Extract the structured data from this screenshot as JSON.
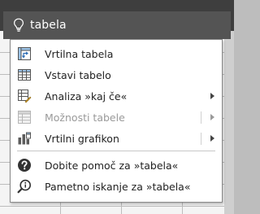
{
  "search": {
    "query": "tabela"
  },
  "menu": {
    "items": [
      {
        "label": "Vrtilna tabela",
        "icon": "pivot-table-icon",
        "submenu": false,
        "disabled": false
      },
      {
        "label": "Vstavi tabelo",
        "icon": "table-icon",
        "submenu": false,
        "disabled": false
      },
      {
        "label": "Analiza »kaj če«",
        "icon": "what-if-analysis-icon",
        "submenu": true,
        "disabled": false
      },
      {
        "label": "Možnosti tabele",
        "icon": "table-options-icon",
        "submenu": true,
        "disabled": true
      },
      {
        "label": "Vrtilni grafikon",
        "icon": "pivot-chart-icon",
        "submenu": true,
        "disabled": false
      }
    ],
    "help": {
      "label": "Dobite pomoč za »tabela«",
      "icon": "help-icon"
    },
    "smart_lookup": {
      "label": "Pametno iskanje za »tabela«",
      "icon": "smart-lookup-icon"
    }
  },
  "colors": {
    "header": "#3e3e3e",
    "search_box": "#545454",
    "menu_bg": "#ffffff",
    "text": "#222222",
    "disabled_text": "#9a9a9a"
  }
}
